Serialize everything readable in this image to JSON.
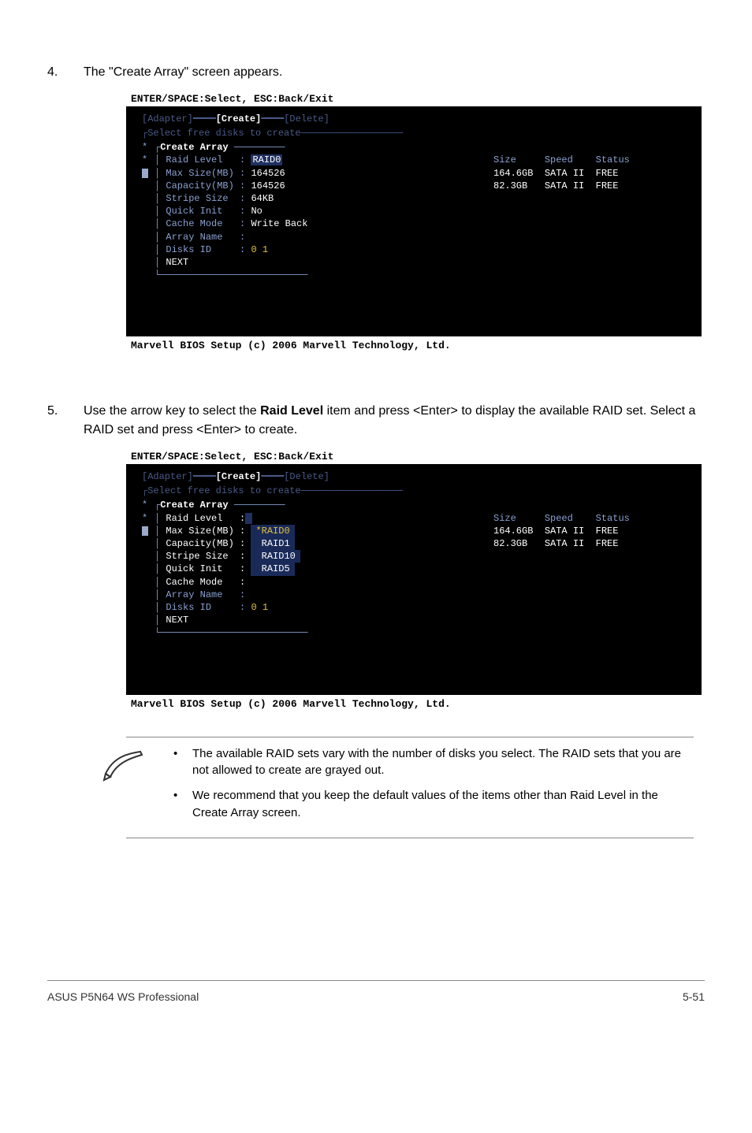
{
  "step4": {
    "num": "4.",
    "text": "The \"Create Array\" screen appears."
  },
  "step5": {
    "num": "5.",
    "pre": "Use the arrow key to select the ",
    "bold": "Raid Level",
    "post": " item and press <Enter> to display the available RAID set. Select a RAID set and press <Enter> to create."
  },
  "bios_hint": "ENTER/SPACE:Select, ESC:Back/Exit",
  "tabs": {
    "adapter": "[Adapter]",
    "create": "[Create]",
    "delete": "[Delete]"
  },
  "panel_select": "Select free disks to create",
  "panel_create": "Create Array",
  "table": {
    "headers": {
      "size": "Size",
      "speed": "Speed",
      "status": "Status"
    },
    "rows": [
      {
        "size": "164.6GB",
        "speed": "SATA II",
        "status": "FREE"
      },
      {
        "size": "82.3GB",
        "speed": "SATA II",
        "status": "FREE"
      }
    ]
  },
  "bios1": {
    "raid_level_label": "Raid Level",
    "raid_level_val": "RAID0",
    "max_size_label": "Max Size(MB)",
    "max_size_val": "164526",
    "capacity_label": "Capacity(MB)",
    "capacity_val": "164526",
    "stripe_label": "Stripe Size",
    "stripe_val": "64KB",
    "quick_label": "Quick Init",
    "quick_val": "No",
    "cache_label": "Cache Mode",
    "cache_val": "Write Back",
    "array_label": "Array Name",
    "array_val": "",
    "disks_label": "Disks ID",
    "disks_val": "0 1",
    "next": "NEXT",
    "chart_data": null
  },
  "bios2": {
    "raid_level_label": "Raid Level",
    "max_size_label": "Max Size(MB)",
    "capacity_label": "Capacity(MB)",
    "stripe_label": "Stripe Size",
    "quick_label": "Quick Init",
    "cache_label": "Cache Mode",
    "array_label": "Array Name",
    "disks_label": "Disks ID",
    "disks_val": "0 1",
    "next": "NEXT",
    "options": {
      "o1": "*RAID0",
      "o2": " RAID1",
      "o3": " RAID10",
      "o4": " RAID5"
    }
  },
  "bios_footer": "Marvell BIOS Setup (c) 2006 Marvell Technology, Ltd.",
  "notes": {
    "n1": "The available RAID sets vary with the number of disks you select. The RAID sets that you are not allowed to create are grayed out.",
    "n2": "We recommend that you keep the default values of the items other than Raid Level in the Create Array screen."
  },
  "footer": {
    "left": "ASUS P5N64 WS Professional",
    "right": "5-51"
  }
}
